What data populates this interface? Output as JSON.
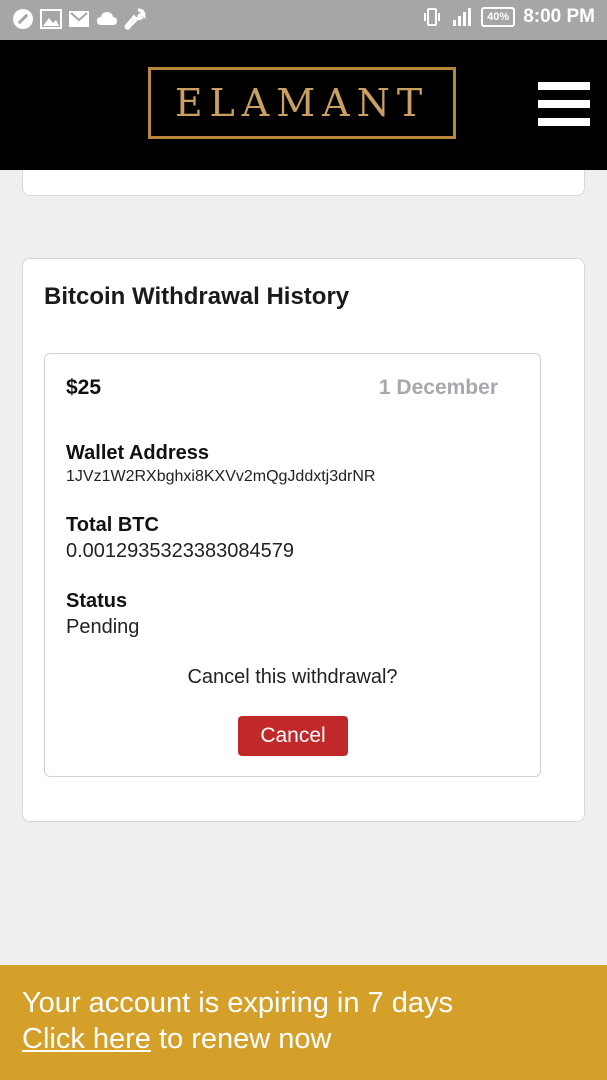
{
  "status_bar": {
    "time": "8:00 PM",
    "battery": "40%",
    "left_icons": [
      "no-entry-icon",
      "gallery-icon",
      "mail-icon",
      "cloud-icon",
      "wrench-icon"
    ],
    "right_icons": [
      "vibrate-icon",
      "signal-icon",
      "battery-icon"
    ]
  },
  "header": {
    "logo_text": "ELAMANT",
    "menu_icon": "hamburger-icon"
  },
  "withdrawals": {
    "title": "Bitcoin Withdrawal History",
    "items": [
      {
        "amount": "$25",
        "date": "1 December",
        "wallet_label": "Wallet Address",
        "wallet_address": "1JVz1W2RXbghxi8KXVv2mQgJddxtj3drNR",
        "btc_label": "Total BTC",
        "btc_value": "0.0012935323383084579",
        "status_label": "Status",
        "status_value": "Pending",
        "cancel_prompt": "Cancel this withdrawal?",
        "cancel_label": "Cancel"
      }
    ]
  },
  "banner": {
    "message": "Your account is expiring in 7 days",
    "link_text": "Click here",
    "suffix": " to renew now"
  },
  "colors": {
    "status_bar": "#a6a6a6",
    "header": "#000000",
    "logo_gold": "#c9a062",
    "cancel_button": "#c0282a",
    "banner": "#d4a02a",
    "background": "#efefef"
  }
}
